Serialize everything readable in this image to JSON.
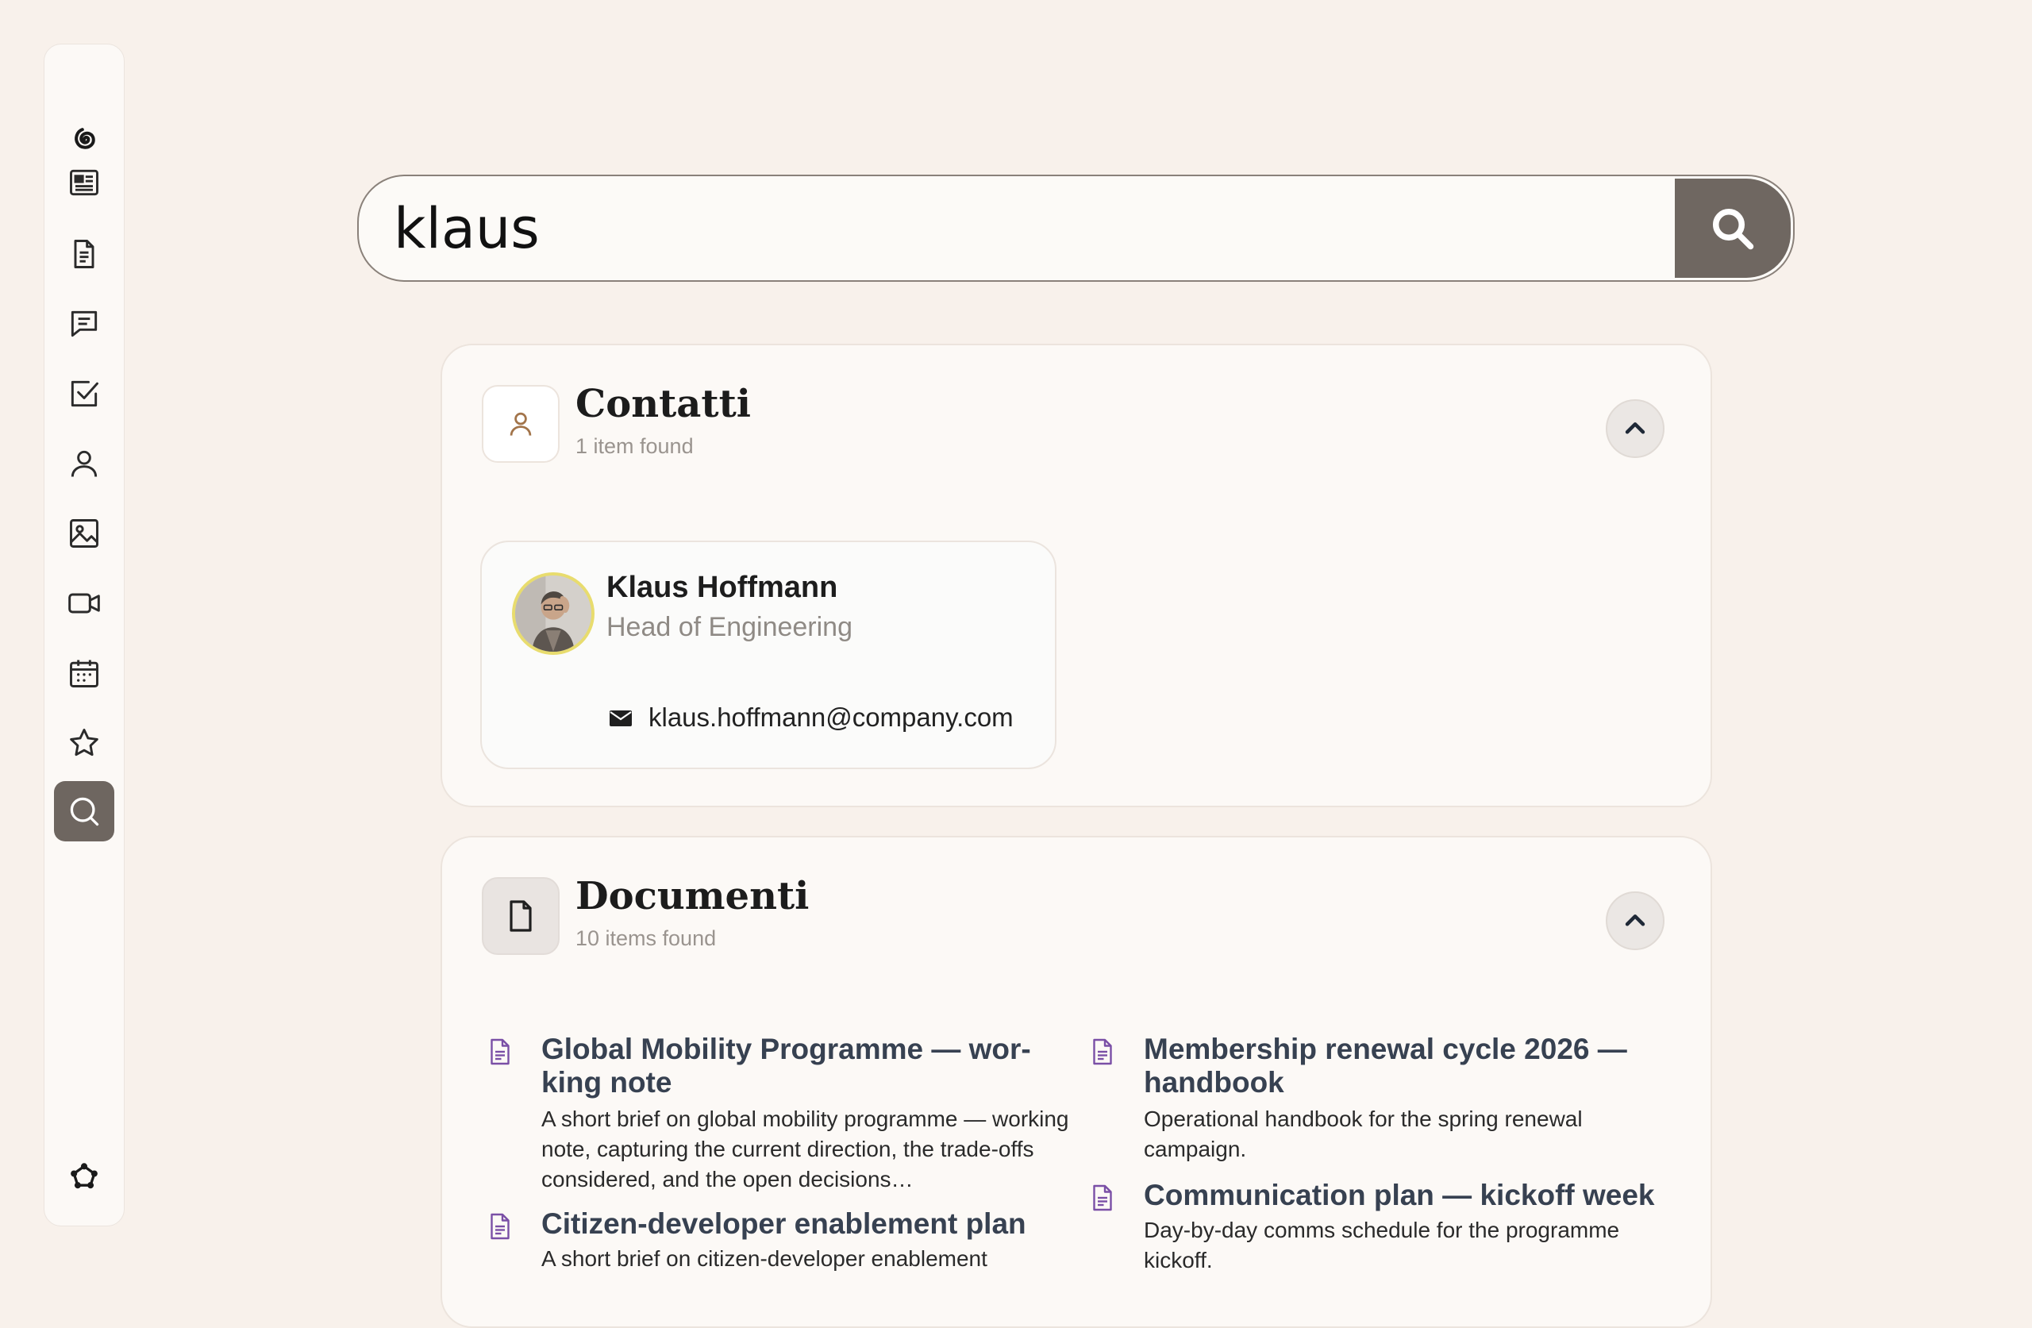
{
  "search": {
    "query": "klaus",
    "placeholder": ""
  },
  "sidebar": {
    "items": [
      {
        "icon": "spiral-logo-icon",
        "active": false
      },
      {
        "icon": "newspaper-icon",
        "active": false
      },
      {
        "icon": "document-icon",
        "active": false
      },
      {
        "icon": "chat-icon",
        "active": false
      },
      {
        "icon": "checkbox-icon",
        "active": false
      },
      {
        "icon": "person-icon",
        "active": false
      },
      {
        "icon": "image-icon",
        "active": false
      },
      {
        "icon": "video-icon",
        "active": false
      },
      {
        "icon": "calendar-icon",
        "active": false
      },
      {
        "icon": "star-icon",
        "active": false
      },
      {
        "icon": "search-icon",
        "active": true
      }
    ],
    "bottom_icon": "network-icon"
  },
  "contacts": {
    "title": "Contatti",
    "count": "1 item found",
    "items": [
      {
        "name": "Klaus Hoffmann",
        "role": "Head of Engineering",
        "email": "klaus.hoffmann@company.com"
      }
    ]
  },
  "documents": {
    "title": "Documenti",
    "count": "10 items found",
    "items": [
      {
        "title": "Global Mobility Programme — wor-king note",
        "description": "A short brief on global mobility programme — working note, capturing the current direction, the trade-offs considered, and the open decisions…"
      },
      {
        "title": "Membership renewal cycle 2026 — handbook",
        "description": "Operational handbook for the spring renewal campaign."
      },
      {
        "title": "Communication plan — kickoff week",
        "description": "Day-by-day comms schedule for the programme kickoff."
      },
      {
        "title": "Citizen-developer enablement plan",
        "description": "A short brief on citizen-developer enablement"
      }
    ]
  },
  "colors": {
    "background": "#f8f1eb",
    "accent": "#6e6660",
    "doc_icon": "#7a4fa6",
    "contact_icon": "#a2744a"
  }
}
